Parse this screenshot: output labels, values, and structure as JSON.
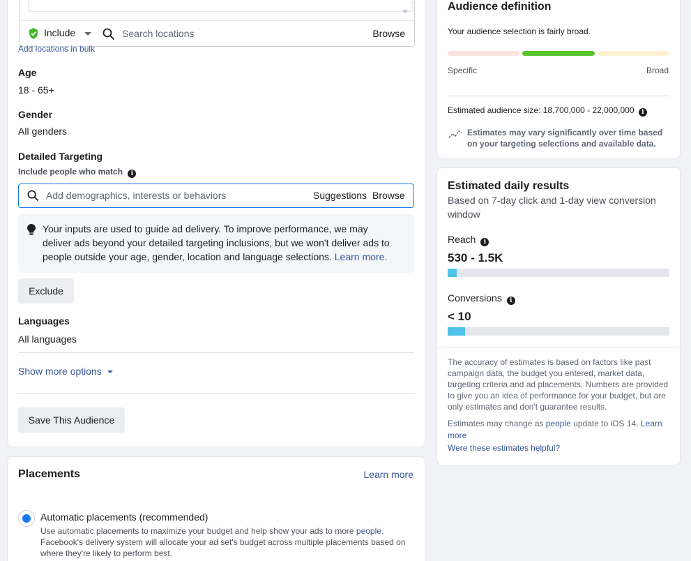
{
  "targeting": {
    "location": {
      "mode_label": "Include",
      "search_placeholder": "Search locations",
      "browse_label": "Browse",
      "bulk_link": "Add locations in bulk"
    },
    "age": {
      "title": "Age",
      "value": "18 - 65+"
    },
    "gender": {
      "title": "Gender",
      "value": "All genders"
    },
    "detailed": {
      "title": "Detailed Targeting",
      "subtitle": "Include people who match",
      "search_placeholder": "Add demographics, interests or behaviors",
      "suggestions_label": "Suggestions",
      "browse_label": "Browse",
      "notice_text": "Your inputs are used to guide ad delivery. To improve performance, we may deliver ads beyond your detailed targeting inclusions, but we won't deliver ads to people outside your age, gender, location and language selections.",
      "notice_link": "Learn more.",
      "exclude_label": "Exclude"
    },
    "languages": {
      "title": "Languages",
      "value": "All languages"
    },
    "more_options_label": "Show more options",
    "save_label": "Save This Audience"
  },
  "placements": {
    "title": "Placements",
    "learn_more": "Learn more",
    "automatic_label": "Automatic placements (recommended)",
    "automatic_selected": true,
    "automatic_desc_before": "Use automatic placements to maximize your budget and help show your ads to more ",
    "automatic_desc_link": "people",
    "automatic_desc_after": ". Facebook's delivery system will allocate your ad set's budget across multiple placements based on where they're likely to perform best."
  },
  "audience_definition": {
    "title": "Audience definition",
    "summary": "Your audience selection is fairly broad.",
    "specific_label": "Specific",
    "broad_label": "Broad",
    "size_label": "Estimated audience size: 18,700,000 - 22,000,000",
    "variance_note": "Estimates may vary significantly over time based on your targeting selections and available data.",
    "colors": {
      "specific": "#fbe3df",
      "active": "#5ac32d",
      "broad": "#fdf2d0"
    }
  },
  "daily_results": {
    "title": "Estimated daily results",
    "subtitle": "Based on 7-day click and 1-day view conversion window",
    "reach_label": "Reach",
    "reach_value": "530 - 1.5K",
    "reach_fill": 0.04,
    "conversions_label": "Conversions",
    "conversions_value": "< 10",
    "conversions_fill": 0.08,
    "accuracy_note": "The accuracy of estimates is based on factors like past campaign data, the budget you entered, market data, targeting criteria and ad placements. Numbers are provided to give you an idea of performance for your budget, but are only estimates and don't guarantee results.",
    "change_note_before": "Estimates may change as ",
    "change_note_link": "people",
    "change_note_middle": " update to iOS 14. ",
    "change_note_learn": "Learn more",
    "helpful_link": "Were these estimates helpful?"
  }
}
